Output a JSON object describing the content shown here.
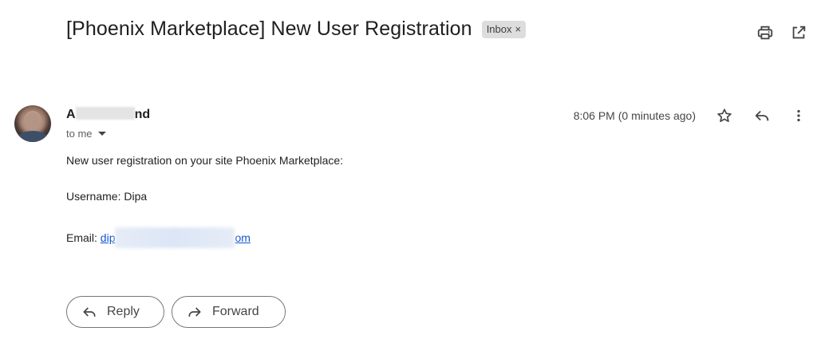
{
  "header": {
    "subject": "[Phoenix Marketplace] New User Registration",
    "label_chip": "Inbox",
    "label_close": "×",
    "icons": [
      "print-icon",
      "open-in-new-window-icon"
    ]
  },
  "message": {
    "sender_prefix": "A",
    "sender_suffix": "nd",
    "recipient_text": "to me",
    "timestamp": "8:06 PM (0 minutes ago)",
    "icons": [
      "star-icon",
      "reply-icon",
      "more-vert-icon"
    ],
    "body": {
      "line1": "New user registration on your site Phoenix Marketplace:",
      "username_line": "Username: Dipa",
      "email_label": "Email: ",
      "email_prefix": "dip",
      "email_suffix": "om"
    }
  },
  "actions": {
    "reply_label": "Reply",
    "forward_label": "Forward"
  },
  "colors": {
    "link": "#1155cc",
    "chip_bg": "#dddddd",
    "button_border": "#747775"
  }
}
